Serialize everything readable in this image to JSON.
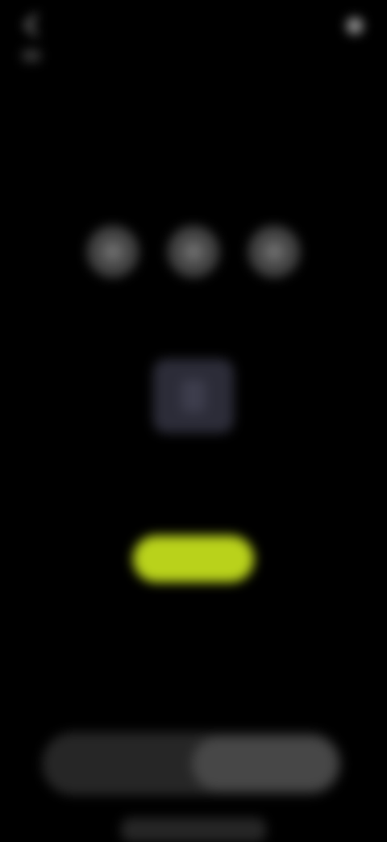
{
  "header": {
    "back_label": "",
    "right_label": ""
  },
  "options": [
    {
      "label": ""
    },
    {
      "label": ""
    },
    {
      "label": ""
    }
  ],
  "empty_state": {
    "title": "",
    "subtitle": "",
    "button_label": ""
  },
  "segment": {
    "left_label": "",
    "right_label": "",
    "active": "right"
  },
  "footer": {
    "label": ""
  },
  "colors": {
    "background": "#000000",
    "accent": "#b9d21b",
    "tile": "#2c2c38",
    "segment_bg": "#262626",
    "segment_active": "#474747"
  }
}
